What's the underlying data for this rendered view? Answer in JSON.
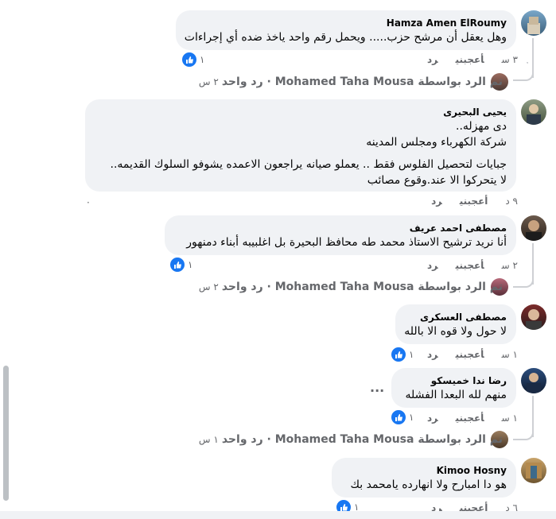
{
  "ui": {
    "like_label": "أعجبني",
    "reply_label": "رد",
    "more_label": "..."
  },
  "comments": [
    {
      "author": "Hamza Amen ElRoumy",
      "lines": [
        "وهل يعقل أن مرشح حزب..... ويحمل رقم واحد ياخذ ضده أي إجراءات"
      ],
      "time": "٣ س",
      "reactions": "١",
      "reply_summary": {
        "text": "تم الرد بواسطة Mohamed Taha Mousa · رد واحد",
        "time": "٢ س"
      }
    },
    {
      "author": "يحيى البحيرى",
      "lines": [
        "دى مهزله..",
        "شركة الكهرباء ومجلس المدينه",
        "",
        "جبايات لتحصيل الفلوس فقط .. يعملو صيانه يراجعون الاعمده يشوفو السلوك القديمه..",
        "لا يتحركوا الا عند.وقوع مصائب"
      ],
      "time": "٩ د",
      "reactions": "",
      "marker": "·"
    },
    {
      "author": "مصطفى احمد عريف",
      "lines": [
        "أنا نريد ترشيح الاستاذ محمد طه محافظ البحيرة بل اغلبيبه أبناء دمنهور"
      ],
      "time": "٢ س",
      "reactions": "١",
      "reply_summary": {
        "text": "تم الرد بواسطة Mohamed Taha Mousa · رد واحد",
        "time": "٢ س"
      }
    },
    {
      "author": "مصطفى العسكرى",
      "lines": [
        "لا حول ولا قوه الا بالله"
      ],
      "time": "١ س",
      "reactions": "١"
    },
    {
      "author": "رضا ندا خميسكو",
      "lines": [
        "منهم لله البعدا الفشله"
      ],
      "time": "١ س",
      "reactions": "١",
      "reply_summary": {
        "text": "تم الرد بواسطة Mohamed Taha Mousa · رد واحد",
        "time": "١ س"
      }
    },
    {
      "author": "Kimoo Hosny",
      "lines": [
        "هو دا امبارح ولا انهارده يامحمد بك"
      ],
      "time": "٦ د",
      "reactions": "١"
    }
  ],
  "colors": {
    "bubble": "#f0f2f5",
    "like_blue": "#1877f2",
    "meta": "#65676b",
    "text": "#050505"
  }
}
